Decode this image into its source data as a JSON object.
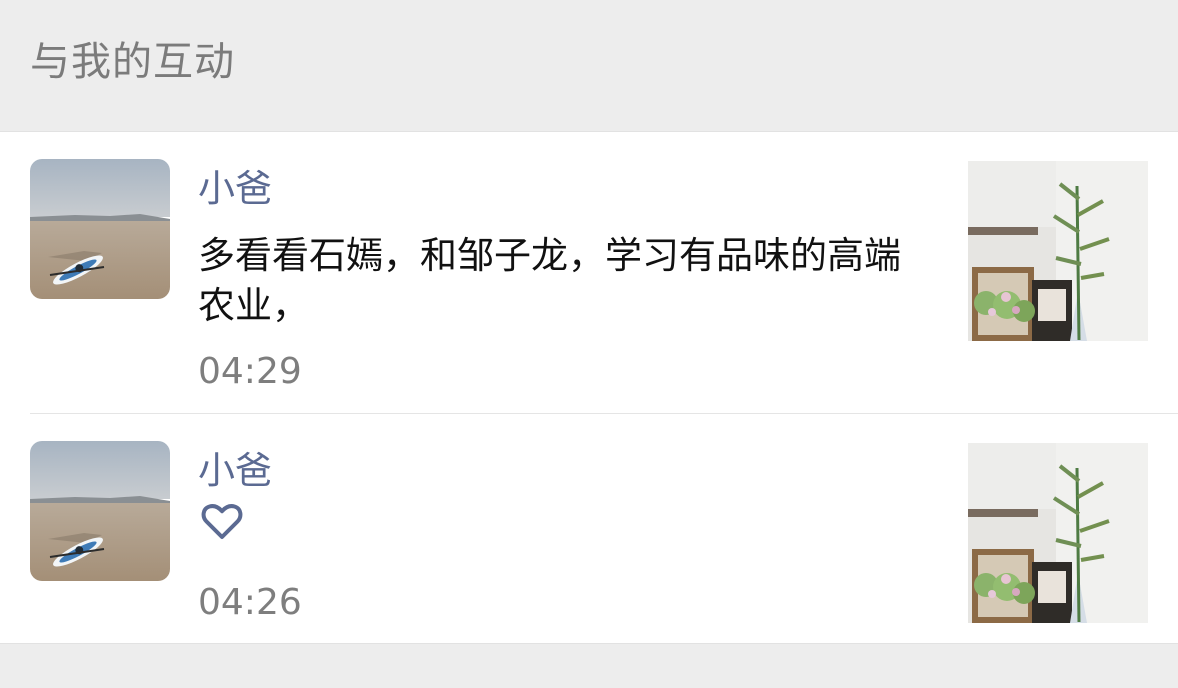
{
  "header": {
    "title": "与我的互动"
  },
  "items": [
    {
      "name": "小爸",
      "comment": "多看看石嫣，和邹子龙，学习有品味的高端农业，",
      "time": "04:29",
      "avatar_icon": "kayak-on-shore-photo",
      "thumb_icon": "plant-in-vase-photo",
      "type": "comment"
    },
    {
      "name": "小爸",
      "time": "04:26",
      "avatar_icon": "kayak-on-shore-photo",
      "thumb_icon": "plant-in-vase-photo",
      "type": "like",
      "like_icon": "heart-icon"
    }
  ],
  "colors": {
    "header_bg": "#ededed",
    "title_text": "#7b7b7b",
    "name_text": "#5b6a92",
    "time_text": "#7e7e7e",
    "body_text": "#111111",
    "heart_stroke": "#5b6a92"
  }
}
